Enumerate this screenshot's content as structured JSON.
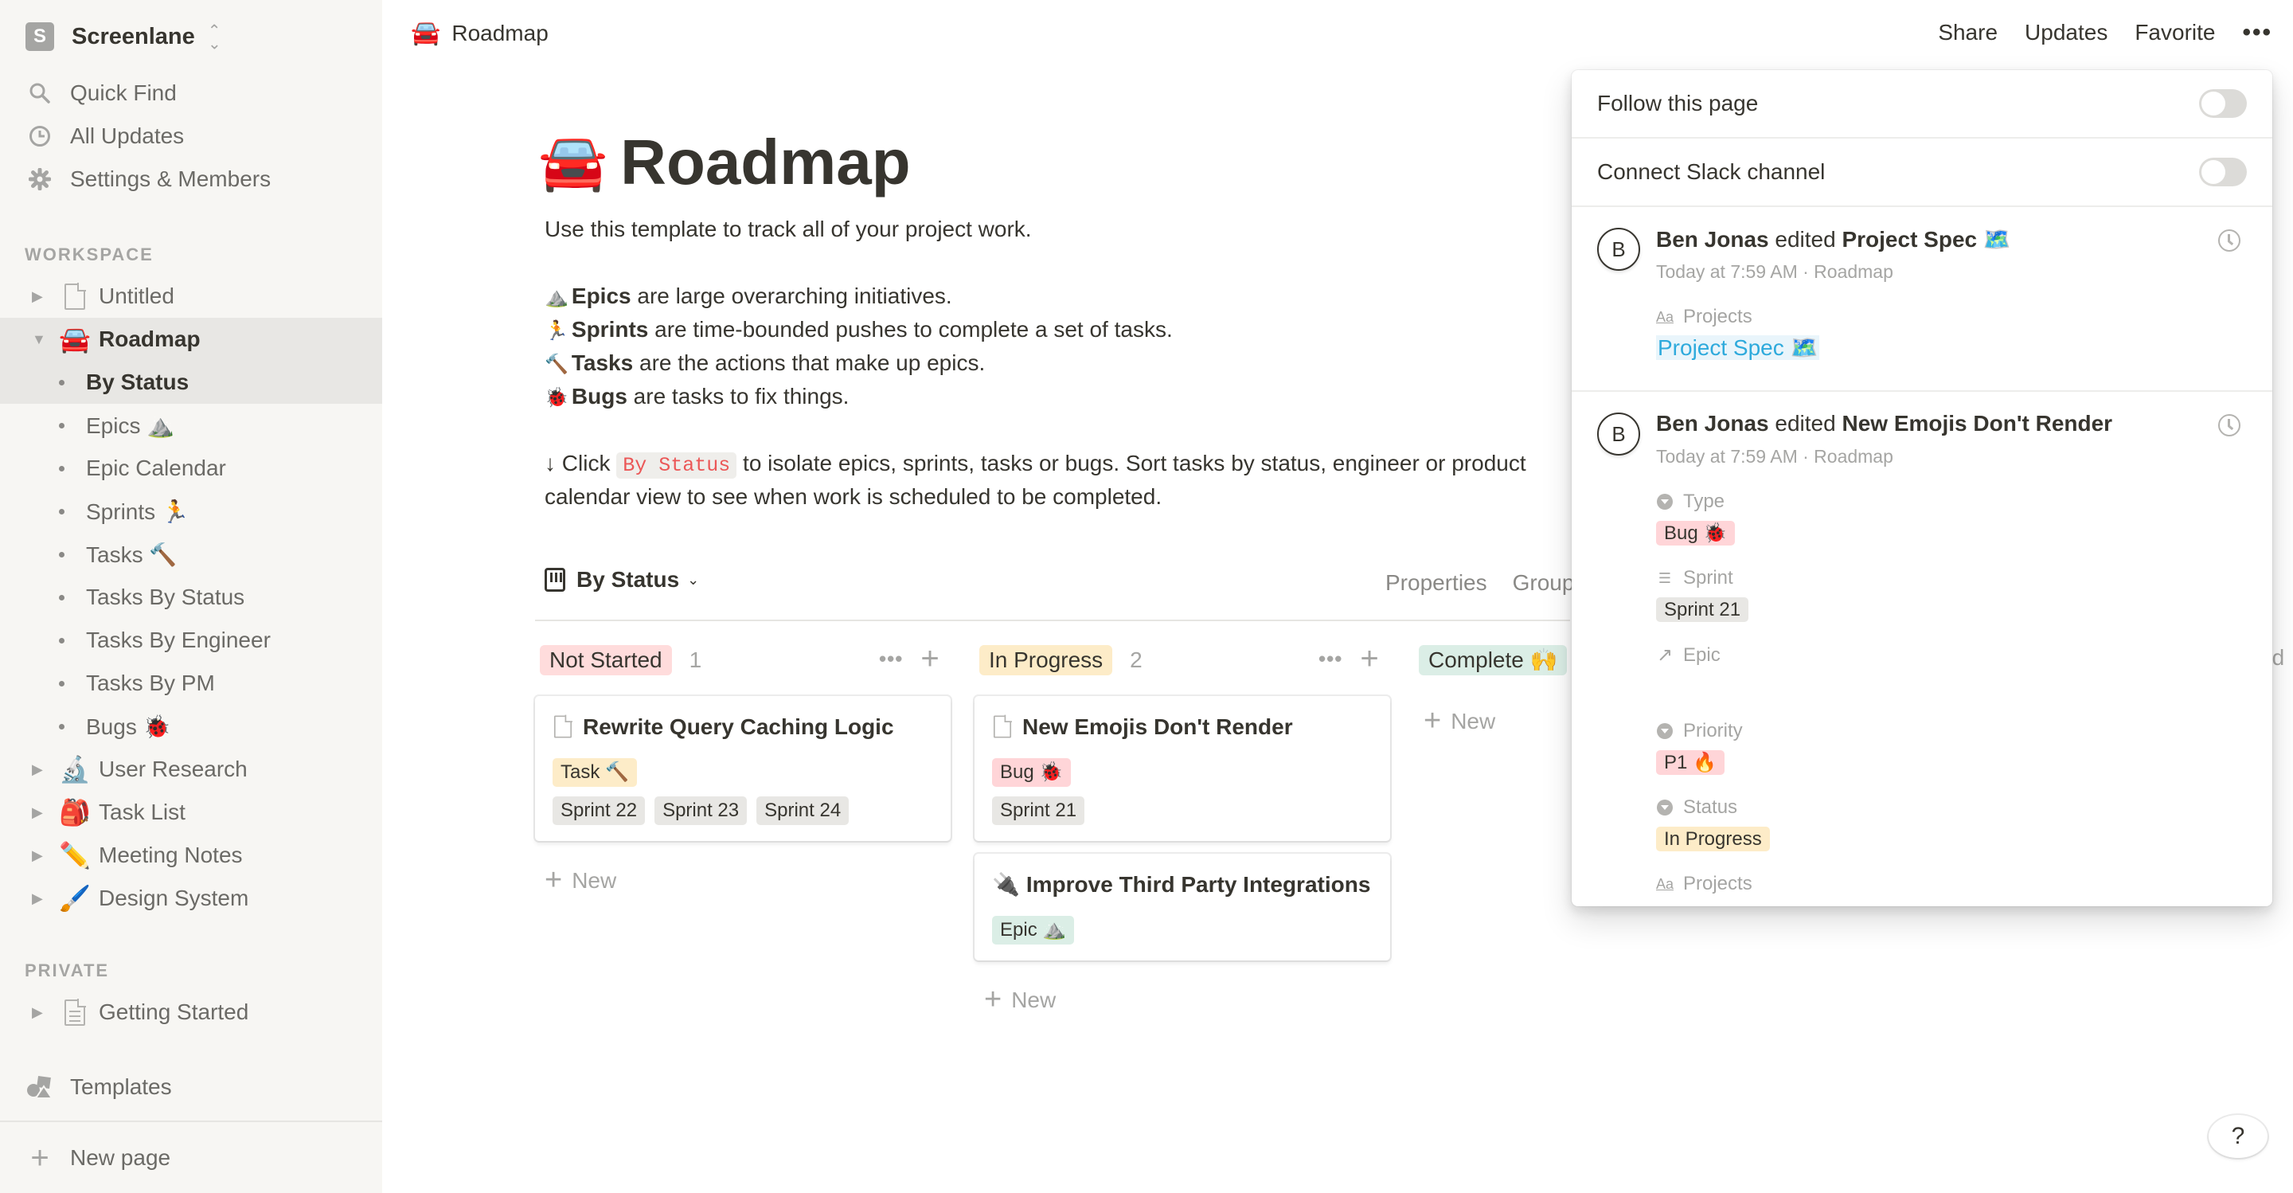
{
  "sidebar": {
    "workspace": {
      "initial": "S",
      "name": "Screenlane"
    },
    "nav": [
      {
        "label": "Quick Find",
        "icon": "search-icon"
      },
      {
        "label": "All Updates",
        "icon": "clock-icon"
      },
      {
        "label": "Settings & Members",
        "icon": "gear-icon"
      }
    ],
    "workspace_label": "WORKSPACE",
    "tree": [
      {
        "label": "Untitled",
        "icon": "page-icon"
      },
      {
        "label": "Roadmap",
        "emoji": "🚘"
      },
      {
        "label": "By Status"
      },
      {
        "label": "Epics ⛰️"
      },
      {
        "label": "Epic Calendar"
      },
      {
        "label": "Sprints 🏃"
      },
      {
        "label": "Tasks 🔨"
      },
      {
        "label": "Tasks By Status"
      },
      {
        "label": "Tasks By Engineer"
      },
      {
        "label": "Tasks By PM"
      },
      {
        "label": "Bugs 🐞"
      },
      {
        "label": "User Research",
        "emoji": "🔬"
      },
      {
        "label": "Task List",
        "emoji": "🎒"
      },
      {
        "label": "Meeting Notes",
        "emoji": "✏️"
      },
      {
        "label": "Design System",
        "emoji": "🖌️"
      }
    ],
    "private_label": "PRIVATE",
    "private": [
      {
        "label": "Getting Started",
        "icon": "page-lines-icon"
      }
    ],
    "templates": "Templates",
    "new_page": "New page"
  },
  "topbar": {
    "breadcrumb": {
      "emoji": "🚘",
      "label": "Roadmap"
    },
    "share": "Share",
    "updates": "Updates",
    "favorite": "Favorite",
    "more": "•••"
  },
  "page": {
    "emoji": "🚘",
    "title": "Roadmap",
    "intro": "Use this template to track all of your project work.",
    "defs": [
      {
        "emoji": "⛰️",
        "term": "Epics",
        "text": " are large overarching initiatives."
      },
      {
        "emoji": "🏃",
        "term": "Sprints",
        "text": " are time-bounded pushes to complete a set of tasks."
      },
      {
        "emoji": "🔨",
        "term": "Tasks",
        "text": " are the actions that make up epics."
      },
      {
        "emoji": "🐞",
        "term": "Bugs",
        "text": " are tasks to fix things."
      }
    ],
    "click_prefix": "↓ Click ",
    "click_code": "By Status",
    "click_suffix": " to isolate epics, sprints, tasks or bugs. Sort tasks by status, engineer or product",
    "click_line2": "calendar view to see when work is scheduled to be completed."
  },
  "board": {
    "view_name": "By Status",
    "properties": "Properties",
    "group": "Group",
    "add_group": "dd",
    "new_label": "New",
    "columns": [
      {
        "label": "Not Started",
        "count": "1",
        "color": "#ffdcdc",
        "cards": [
          {
            "title": "Rewrite Query Caching Logic",
            "icon": "page-icon",
            "tags": [
              {
                "label": "Task 🔨",
                "color": "#fdecc8"
              }
            ],
            "sprints": [
              "Sprint 22",
              "Sprint 23",
              "Sprint 24"
            ]
          }
        ]
      },
      {
        "label": "In Progress",
        "count": "2",
        "color": "#fdecc8",
        "cards": [
          {
            "title": "New Emojis Don't Render",
            "icon": "page-icon",
            "tags": [
              {
                "label": "Bug 🐞",
                "color": "#ffd5d8"
              }
            ],
            "sprints": [
              "Sprint 21"
            ]
          },
          {
            "title": "Improve Third Party Integrations",
            "emoji": "🔌",
            "tags": [
              {
                "label": "Epic ⛰️",
                "color": "#dbeee6"
              }
            ],
            "sprints": []
          }
        ]
      },
      {
        "label": "Complete 🙌",
        "count": "",
        "color": "#dbeee6",
        "cards": []
      }
    ]
  },
  "updates_popover": {
    "follow": "Follow this page",
    "follow_on": false,
    "slack": "Connect Slack channel",
    "slack_on": false,
    "items": [
      {
        "avatar": "B",
        "user": "Ben Jonas",
        "verb": " edited ",
        "target": "Project Spec 🗺️",
        "meta": "Today at 7:59 AM · Roadmap",
        "props": [
          {
            "label": "Projects",
            "icon": "text-icon",
            "value": "Project Spec 🗺️",
            "kind": "link"
          }
        ]
      },
      {
        "avatar": "B",
        "user": "Ben Jonas",
        "verb": " edited ",
        "target": "New Emojis Don't Render",
        "meta": "Today at 7:59 AM · Roadmap",
        "props": [
          {
            "label": "Type",
            "icon": "select-icon",
            "value": "Bug 🐞",
            "color": "#ffd5d8"
          },
          {
            "label": "Sprint",
            "icon": "list-icon",
            "value": "Sprint 21",
            "color": "#e8e7e4"
          },
          {
            "label": "Epic",
            "icon": "relation-arrow-icon",
            "value": ""
          },
          {
            "label": "Priority",
            "icon": "select-icon",
            "value": "P1 🔥",
            "color": "#ffd5d8"
          },
          {
            "label": "Status",
            "icon": "select-icon",
            "value": "In Progress",
            "color": "#fdecc8"
          },
          {
            "label": "Projects",
            "icon": "text-icon",
            "value": ""
          }
        ]
      }
    ]
  },
  "help": "?"
}
